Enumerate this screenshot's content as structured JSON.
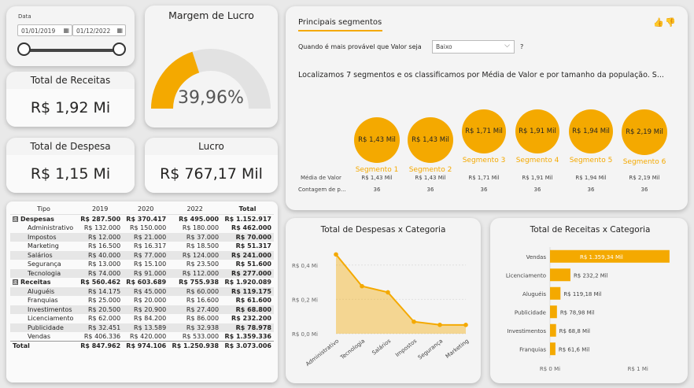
{
  "filters": {
    "date_label": "Data",
    "start_date": "01/01/2019",
    "end_date": "01/12/2022"
  },
  "kpis": {
    "receitas": {
      "title": "Total de Receitas",
      "value": "R$ 1,92 Mi"
    },
    "despesa": {
      "title": "Total de Despesa",
      "value": "R$ 1,15 Mi"
    },
    "lucro": {
      "title": "Lucro",
      "value": "R$ 767,17 Mil"
    }
  },
  "gauge": {
    "title": "Margem de Lucro",
    "value_label": "39,96%",
    "fraction": 0.3996
  },
  "matrix": {
    "headers": [
      "Tipo",
      "2019",
      "2020",
      "2022",
      "Total"
    ],
    "rows": [
      {
        "kind": "group",
        "expander": "⊟",
        "label": "Despesas",
        "values": [
          "R$ 287.500",
          "R$ 370.417",
          "R$ 495.000",
          "R$ 1.152.917"
        ]
      },
      {
        "kind": "child",
        "label": "Administrativo",
        "values": [
          "R$ 132.000",
          "R$ 150.000",
          "R$ 180.000",
          "R$ 462.000"
        ]
      },
      {
        "kind": "child",
        "label": "Impostos",
        "values": [
          "R$ 12.000",
          "R$ 21.000",
          "R$ 37.000",
          "R$ 70.000"
        ]
      },
      {
        "kind": "child",
        "label": "Marketing",
        "values": [
          "R$ 16.500",
          "R$ 16.317",
          "R$ 18.500",
          "R$ 51.317"
        ]
      },
      {
        "kind": "child",
        "label": "Salários",
        "values": [
          "R$ 40.000",
          "R$ 77.000",
          "R$ 124.000",
          "R$ 241.000"
        ]
      },
      {
        "kind": "child",
        "label": "Segurança",
        "values": [
          "R$ 13.000",
          "R$ 15.100",
          "R$ 23.500",
          "R$ 51.600"
        ]
      },
      {
        "kind": "child",
        "label": "Tecnologia",
        "values": [
          "R$ 74.000",
          "R$ 91.000",
          "R$ 112.000",
          "R$ 277.000"
        ]
      },
      {
        "kind": "group",
        "expander": "⊟",
        "label": "Receitas",
        "values": [
          "R$ 560.462",
          "R$ 603.689",
          "R$ 755.938",
          "R$ 1.920.089"
        ]
      },
      {
        "kind": "child",
        "label": "Aluguéis",
        "values": [
          "R$ 14.175",
          "R$ 45.000",
          "R$ 60.000",
          "R$ 119.175"
        ]
      },
      {
        "kind": "child",
        "label": "Franquias",
        "values": [
          "R$ 25.000",
          "R$ 20.000",
          "R$ 16.600",
          "R$ 61.600"
        ]
      },
      {
        "kind": "child",
        "label": "Investimentos",
        "values": [
          "R$ 20.500",
          "R$ 20.900",
          "R$ 27.400",
          "R$ 68.800"
        ]
      },
      {
        "kind": "child",
        "label": "Licenciamento",
        "values": [
          "R$ 62.000",
          "R$ 84.200",
          "R$ 86.000",
          "R$ 232.200"
        ]
      },
      {
        "kind": "child",
        "label": "Publicidade",
        "values": [
          "R$ 32.451",
          "R$ 13.589",
          "R$ 32.938",
          "R$ 78.978"
        ]
      },
      {
        "kind": "child",
        "label": "Vendas",
        "values": [
          "R$ 406.336",
          "R$ 420.000",
          "R$ 533.000",
          "R$ 1.359.336"
        ]
      },
      {
        "kind": "total",
        "label": "Total",
        "values": [
          "R$ 847.962",
          "R$ 974.106",
          "R$ 1.250.938",
          "R$ 3.073.006"
        ]
      }
    ]
  },
  "segments_panel": {
    "tab": "Principais segmentos",
    "question_prefix": "Quando é mais provável que Valor seja",
    "question_value": "Baixo",
    "question_suffix": "?",
    "summary": "Localizamos 7 segmentos e os classificamos por Média de Valor e por tamanho da população. S...",
    "row_label_avg": "Média de Valor",
    "row_label_count": "Contagem de p...",
    "segments": [
      {
        "name": "Segmento 1",
        "value": "R$ 1,43 Mil",
        "count": "36"
      },
      {
        "name": "Segmento 2",
        "value": "R$ 1,43 Mil",
        "count": "36"
      },
      {
        "name": "Segmento 3",
        "value": "R$ 1,71 Mil",
        "count": "36"
      },
      {
        "name": "Segmento 4",
        "value": "R$ 1,91 Mil",
        "count": "36"
      },
      {
        "name": "Segmento 5",
        "value": "R$ 1,94 Mil",
        "count": "36"
      },
      {
        "name": "Segmento 6",
        "value": "R$ 2,19 Mil",
        "count": "36"
      }
    ]
  },
  "chart_data": [
    {
      "type": "area",
      "title": "Total de Despesas x Categoria",
      "categories": [
        "Administrativo",
        "Tecnologia",
        "Salários",
        "Impostos",
        "Segurança",
        "Marketing"
      ],
      "values": [
        0.462,
        0.277,
        0.241,
        0.07,
        0.0516,
        0.0513
      ],
      "y_ticks": [
        "R$ 0,0 Mi",
        "R$ 0,2 Mi",
        "R$ 0,4 Mi"
      ],
      "ylim": [
        0,
        0.5
      ],
      "color": "#f4a900"
    },
    {
      "type": "bar",
      "orientation": "horizontal",
      "title": "Total de Receitas x Categoria",
      "categories": [
        "Vendas",
        "Licenciamento",
        "Aluguéis",
        "Publicidade",
        "Investimentos",
        "Franquias"
      ],
      "values": [
        1.35934,
        0.2322,
        0.11918,
        0.07898,
        0.0688,
        0.0616
      ],
      "data_labels": [
        "R$ 1.359,34 Mil",
        "R$ 232,2 Mil",
        "R$ 119,18 Mil",
        "R$ 78,98 Mil",
        "R$ 68,8 Mil",
        "R$ 61,6 Mil"
      ],
      "x_ticks": [
        "R$ 0 Mi",
        "R$ 1 Mi"
      ],
      "xlim": [
        0,
        1.45
      ],
      "color": "#f4a900"
    }
  ]
}
